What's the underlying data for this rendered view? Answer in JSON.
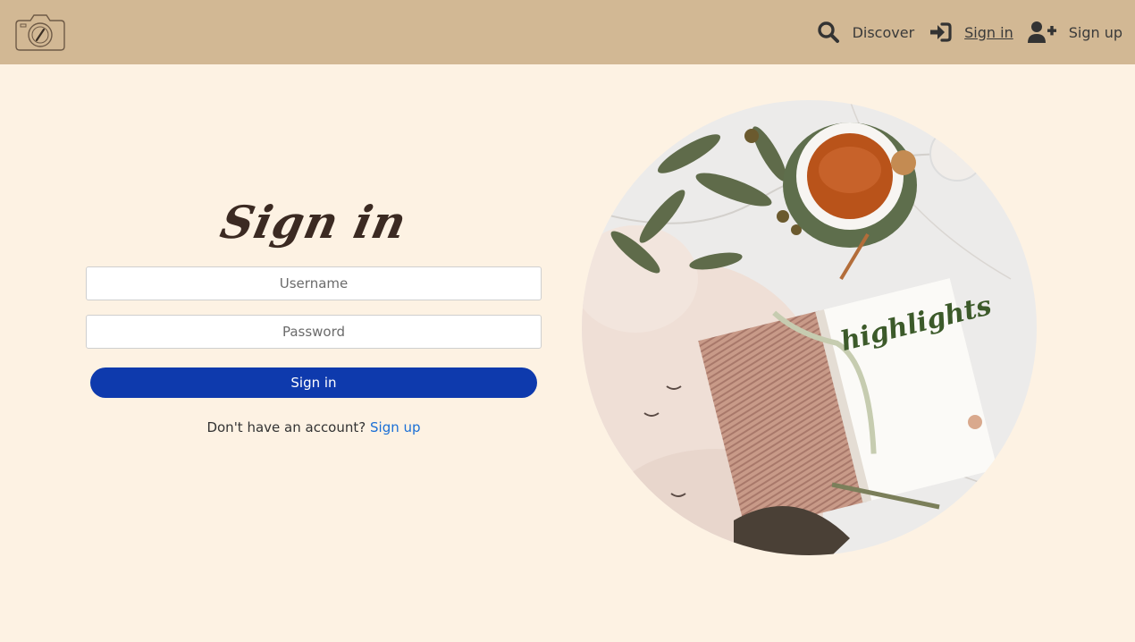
{
  "nav": {
    "logo_icon": "camera-logo-icon",
    "discover_label": "Discover",
    "signin_label": "Sign in",
    "signup_label": "Sign up",
    "icons": {
      "search": "search-icon",
      "signin": "sign-in-icon",
      "signup": "user-plus-icon"
    }
  },
  "signin_form": {
    "title": "Sign in",
    "username_placeholder": "Username",
    "password_placeholder": "Password",
    "submit_label": "Sign in",
    "no_account_text": "Don't have an account?",
    "signup_link": "Sign up"
  },
  "hero": {
    "notebook_text": "highlights"
  },
  "colors": {
    "navbar": "#d2b894",
    "background": "#fdf2e3",
    "button": "#0e3aad",
    "link": "#1a6fd6"
  }
}
